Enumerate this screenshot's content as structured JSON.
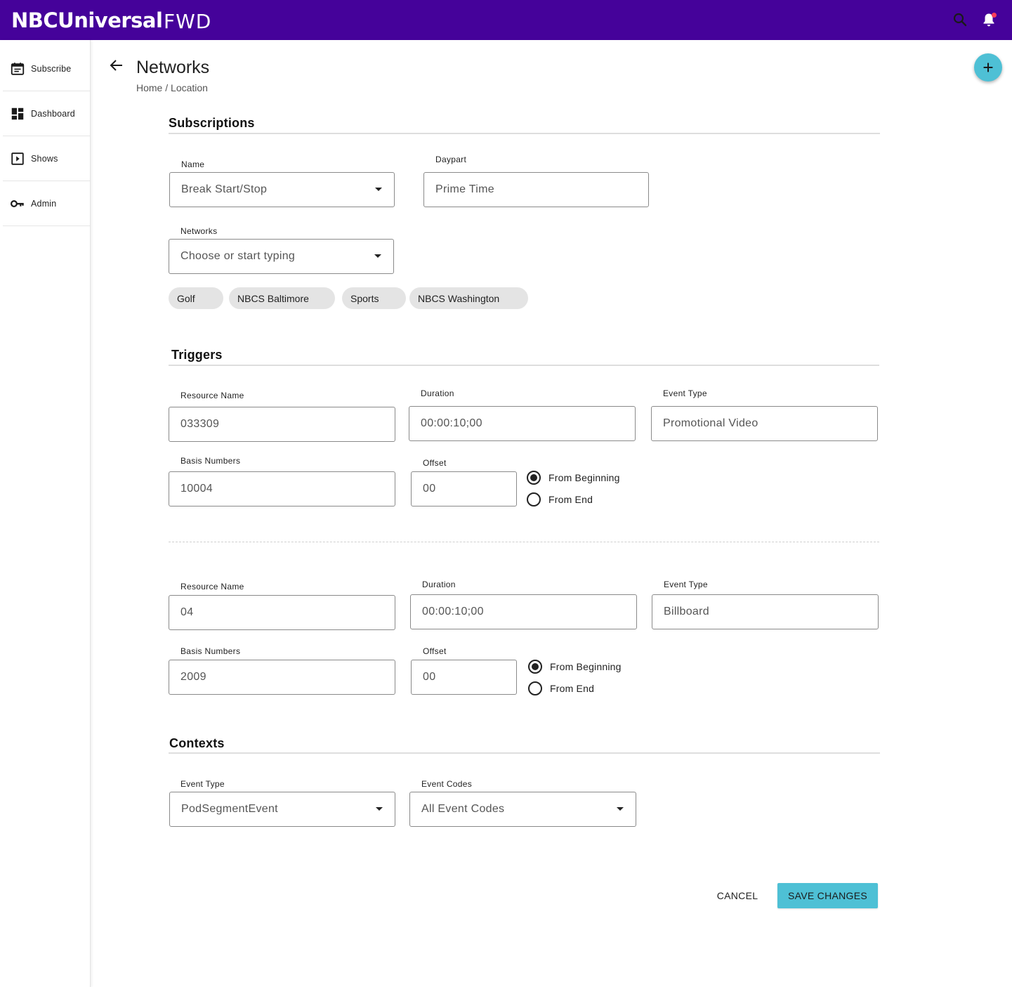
{
  "header": {
    "brand": "NBCUniversal",
    "product": "FWD",
    "search_icon": "search-icon",
    "notification_icon": "bell-icon",
    "colors": {
      "bar": "#45029a",
      "notification_dot": "#ff3e5a"
    }
  },
  "sidebar": {
    "items": [
      {
        "label": "Subscribe",
        "icon": "calendar-icon"
      },
      {
        "label": "Dashboard",
        "icon": "dashboard-icon"
      },
      {
        "label": "Shows",
        "icon": "play-box-icon"
      },
      {
        "label": "Admin",
        "icon": "key-icon"
      }
    ]
  },
  "page": {
    "title": "Networks",
    "breadcrumb": {
      "home": "Home",
      "separator": " / ",
      "current": "Location"
    },
    "add_button_icon": "plus-icon",
    "accent_color": "#4ec0d5"
  },
  "subscriptions": {
    "title": "Subscriptions",
    "name": {
      "label": "Name",
      "value": "Break Start/Stop"
    },
    "daypart": {
      "label": "Daypart",
      "placeholder": "Prime Time"
    },
    "networks": {
      "label": "Networks",
      "placeholder": "Choose or start typing"
    },
    "chips": [
      "Golf",
      "NBCS Baltimore",
      "Sports",
      "NBCS Washington"
    ]
  },
  "triggers": {
    "title": "Triggers",
    "items": [
      {
        "resource_name": {
          "label": "Resource Name",
          "value": "033309"
        },
        "duration": {
          "label": "Duration",
          "value": "00:00:10;00"
        },
        "event_type": {
          "label": "Event Type",
          "value": "Promotional Video"
        },
        "basis_numbers": {
          "label": "Basis Numbers",
          "value": "10004"
        },
        "offset": {
          "label": "Offset",
          "value": "00"
        },
        "offset_from": {
          "options": [
            "From Beginning",
            "From End"
          ],
          "selected": "From Beginning"
        }
      },
      {
        "resource_name": {
          "label": "Resource Name",
          "value": "04"
        },
        "duration": {
          "label": "Duration",
          "value": "00:00:10;00"
        },
        "event_type": {
          "label": "Event Type",
          "value": "Billboard"
        },
        "basis_numbers": {
          "label": "Basis Numbers",
          "value": "2009"
        },
        "offset": {
          "label": "Offset",
          "value": "00"
        },
        "offset_from": {
          "options": [
            "From Beginning",
            "From End"
          ],
          "selected": "From Beginning"
        }
      }
    ]
  },
  "contexts": {
    "title": "Contexts",
    "event_type": {
      "label": "Event Type",
      "value": "PodSegmentEvent"
    },
    "event_codes": {
      "label": "Event Codes",
      "value": "All Event Codes"
    }
  },
  "actions": {
    "cancel": "CANCEL",
    "save": "SAVE CHANGES"
  }
}
